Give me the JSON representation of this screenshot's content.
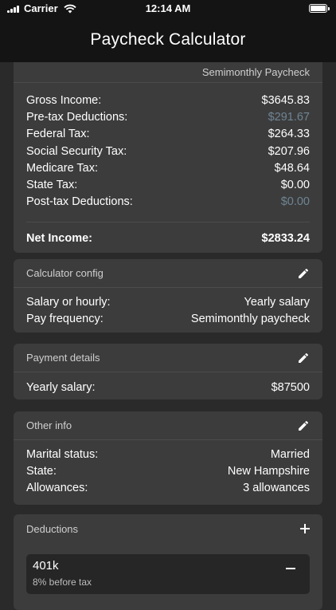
{
  "status": {
    "carrier": "Carrier",
    "time": "12:14 AM"
  },
  "nav": {
    "title": "Paycheck Calculator"
  },
  "summary": {
    "header": "Semimonthly Paycheck",
    "rows": [
      {
        "label": "Gross Income:",
        "value": "$3645.83"
      },
      {
        "label": "Pre-tax Deductions:",
        "value": "$291.67"
      },
      {
        "label": "Federal Tax:",
        "value": "$264.33"
      },
      {
        "label": "Social Security Tax:",
        "value": "$207.96"
      },
      {
        "label": "Medicare Tax:",
        "value": "$48.64"
      },
      {
        "label": "State Tax:",
        "value": "$0.00"
      },
      {
        "label": "Post-tax Deductions:",
        "value": "$0.00"
      }
    ],
    "net_label": "Net Income:",
    "net_value": "$2833.24"
  },
  "config": {
    "header": "Calculator config",
    "rows": [
      {
        "label": "Salary or hourly:",
        "value": "Yearly salary"
      },
      {
        "label": "Pay frequency:",
        "value": "Semimonthly paycheck"
      }
    ]
  },
  "payment": {
    "header": "Payment details",
    "rows": [
      {
        "label": "Yearly salary:",
        "value": "$87500"
      }
    ]
  },
  "other": {
    "header": "Other info",
    "rows": [
      {
        "label": "Marital status:",
        "value": "Married"
      },
      {
        "label": "State:",
        "value": "New Hampshire"
      },
      {
        "label": "Allowances:",
        "value": "3 allowances"
      }
    ]
  },
  "deductions": {
    "header": "Deductions",
    "items": [
      {
        "name": "401k",
        "detail": "8% before tax"
      }
    ]
  },
  "colors": {
    "background": "#2a2a2a",
    "card": "#3c3c3c",
    "muted_value": "#6f8594",
    "bar": "#141414"
  }
}
